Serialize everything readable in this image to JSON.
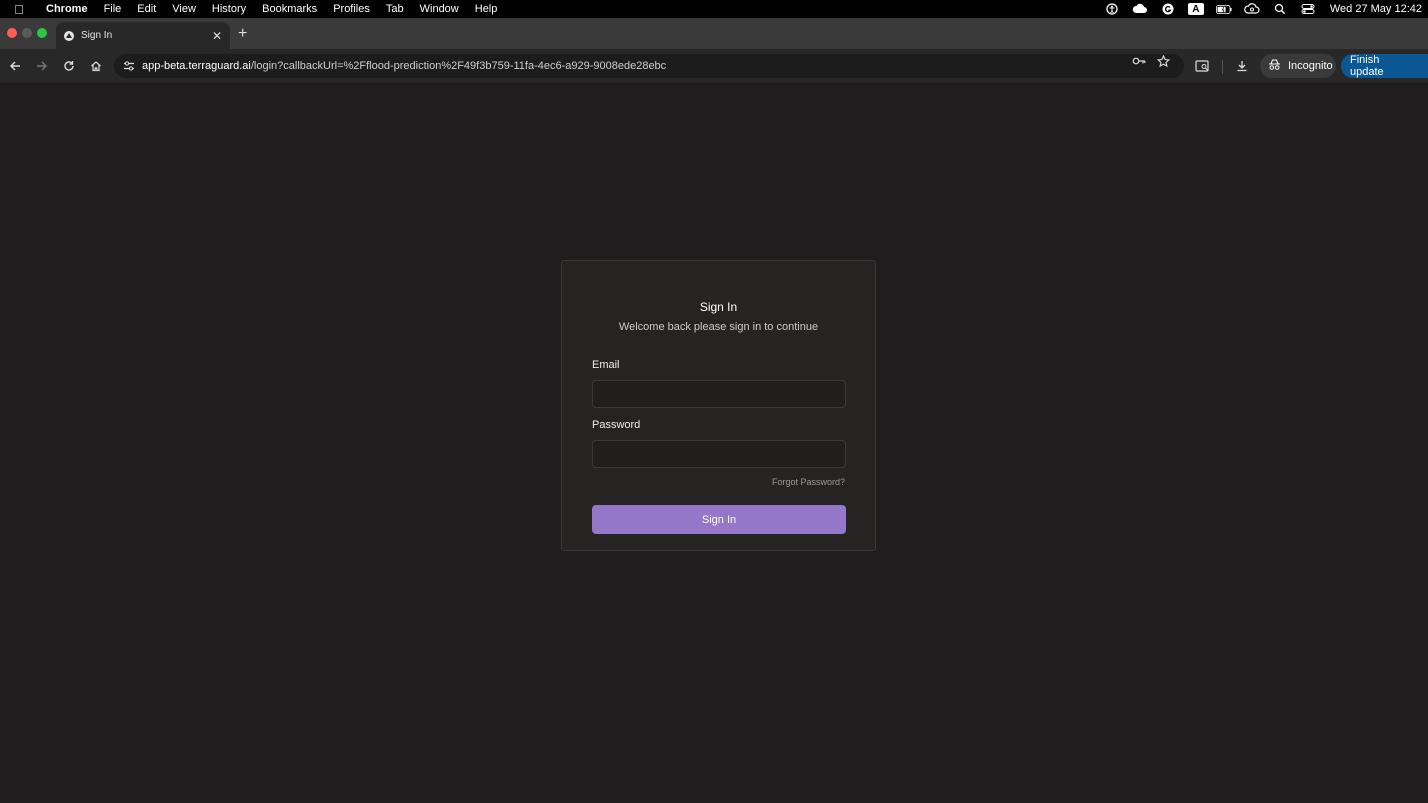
{
  "menubar": {
    "app_name": "Chrome",
    "items": [
      "File",
      "Edit",
      "View",
      "History",
      "Bookmarks",
      "Profiles",
      "Tab",
      "Window",
      "Help"
    ],
    "a_badge": "A",
    "clock": "Wed 27 May  12:42"
  },
  "browser": {
    "tab_title": "Sign In",
    "url_host": "app-beta.terraguard.ai",
    "url_path": "/login?callbackUrl=%2Fflood-prediction%2F49f3b759-11fa-4ec6-a929-9008ede28ebc",
    "incognito_label": "Incognito",
    "update_label": "Finish update"
  },
  "signin": {
    "title": "Sign In",
    "subtitle": "Welcome back please sign in to continue",
    "email_label": "Email",
    "email_value": "",
    "password_label": "Password",
    "password_value": "",
    "forgot_label": "Forgot Password?",
    "button_label": "Sign In"
  },
  "colors": {
    "page_bg": "#1f1d1d",
    "card_bg": "#262423",
    "accent": "#9477c8",
    "update_button": "#0b5794"
  },
  "icons": {
    "menubar": [
      "apple-icon",
      "accessibility-icon",
      "cloud-icon",
      "grammarly-icon",
      "input-source-icon",
      "battery-icon",
      "creative-cloud-icon",
      "spotlight-icon",
      "control-center-icon"
    ],
    "toolbar": [
      "back-icon",
      "forward-icon",
      "reload-icon",
      "home-icon",
      "site-settings-icon",
      "password-key-icon",
      "bookmark-star-icon",
      "tab-search-icon",
      "download-icon",
      "incognito-icon",
      "more-icon"
    ]
  }
}
